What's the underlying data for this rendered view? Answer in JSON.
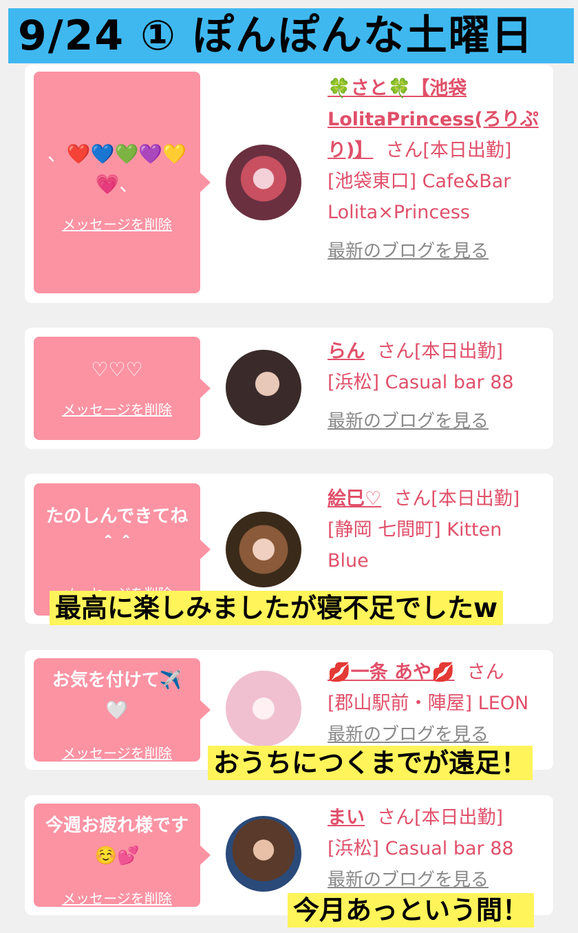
{
  "banner": {
    "title": "9/24 ① ぽんぽんな土曜日"
  },
  "entries": [
    {
      "message": "、❤️💙💚💜💛\n💗、",
      "delete_label": "メッセージを削除",
      "name": "🍀さと🍀【池袋LolitaPrincess(ろりぷり)】",
      "honorific": "さん[本日出勤]",
      "location": "[池袋東口] Cafe&Bar Lolita×Princess",
      "blog_label": "最新のブログを見る",
      "avatar_color": "#c85060"
    },
    {
      "message": "♡♡♡",
      "delete_label": "メッセージを削除",
      "name": "らん",
      "honorific": "さん[本日出勤]",
      "location": "[浜松] Casual bar 88",
      "blog_label": "最新のブログを見る",
      "avatar_color": "#2a2a2a"
    },
    {
      "message": "たのしんできてね\n＾＾",
      "delete_label": "メッセージを削除",
      "name": "絵巳♡",
      "honorific": "さん[本日出勤]",
      "location": "[静岡 七間町] Kitten Blue",
      "blog_label": "",
      "avatar_color": "#8a5a3a"
    },
    {
      "message": "お気を付けて✈️\n🤍",
      "delete_label": "メッセージを削除",
      "name": "💋一条 あや💋",
      "honorific": "さん",
      "location": "[郡山駅前・陣屋] LEON",
      "blog_label": "最新のブログを見る",
      "avatar_color": "#f0c0d0"
    },
    {
      "message": "今週お疲れ様です\n☺️💕",
      "delete_label": "メッセージを削除",
      "name": "まい",
      "honorific": "さん[本日出勤]",
      "location": "[浜松] Casual bar 88",
      "blog_label": "最新のブログを見る",
      "avatar_color": "#5a3a2a"
    }
  ],
  "captions": {
    "c1": "最高に楽しみましたが寝不足でしたw",
    "c2": "おうちにつくまでが遠足！",
    "c3": "今月あっという間！"
  },
  "colors": {
    "banner": "#3fb8f0",
    "message_bubble": "#fb93a3",
    "link_text": "#e0506a",
    "caption_bg": "#fff45a"
  }
}
